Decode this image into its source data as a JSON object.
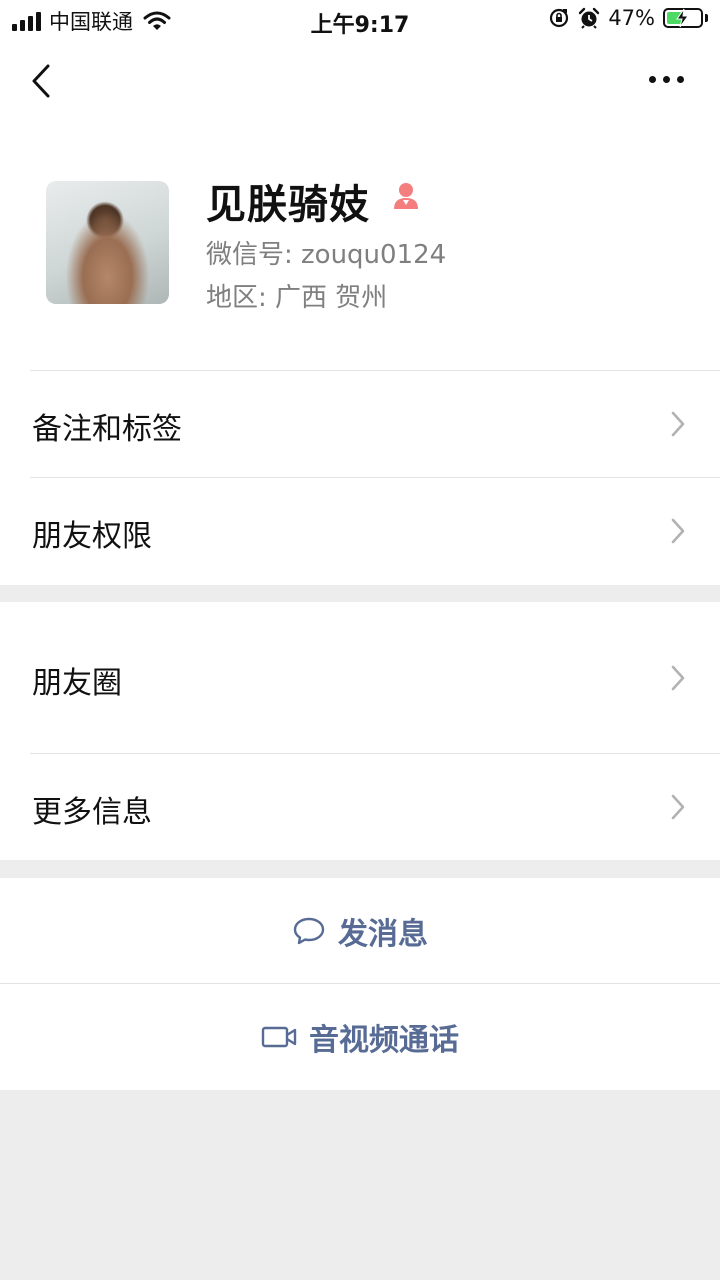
{
  "status_bar": {
    "carrier": "中国联通",
    "time": "上午9:17",
    "battery_percent": "47%",
    "battery_level": 0.47,
    "icons": [
      "signal-icon",
      "wifi-icon",
      "orientation-lock-icon",
      "alarm-icon",
      "battery-charging-icon"
    ]
  },
  "nav": {
    "back_icon": "chevron-left-icon",
    "more_icon": "more-dots-icon"
  },
  "profile": {
    "name": "见朕骑妓",
    "gender_icon": "female-icon",
    "wechat_id": "微信号: zouqu0124",
    "region": "地区: 广西 贺州"
  },
  "menu": {
    "remarks_tags": "备注和标签",
    "friend_permissions": "朋友权限",
    "moments": "朋友圈",
    "more_info": "更多信息"
  },
  "actions": {
    "send_message": "发消息",
    "video_call": "音视频通话"
  },
  "colors": {
    "link_blue": "#576b95",
    "female_pink": "#f37e7d",
    "background_gray": "#ededed"
  }
}
